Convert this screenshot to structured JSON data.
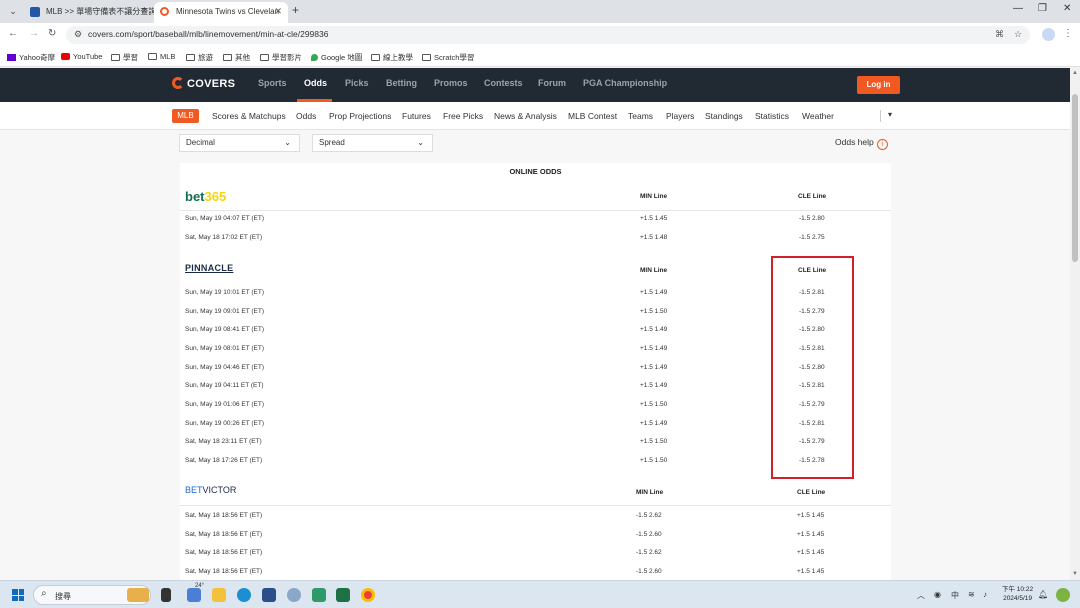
{
  "browser": {
    "tabs": [
      {
        "title": "MLB >> 單場守備表不讓分查詢"
      },
      {
        "title": "Minnesota Twins vs Clevelan"
      }
    ],
    "url": "covers.com/sport/baseball/mlb/linemovement/min-at-cle/299836",
    "bookmarks": [
      "Yahoo奇摩",
      "YouTube",
      "學習",
      "MLB",
      "旅遊",
      "其他",
      "學習影片",
      "Google 地圖",
      "線上教學",
      "Scratch學習"
    ]
  },
  "site": {
    "logo": "COVERS",
    "nav": [
      "Sports",
      "Odds",
      "Picks",
      "Betting",
      "Promos",
      "Contests",
      "Forum",
      "PGA Championship"
    ],
    "login": "Log in",
    "subnav": [
      "MLB",
      "Scores & Matchups",
      "Odds",
      "Prop Projections",
      "Futures",
      "Free Picks",
      "News & Analysis",
      "MLB Contest",
      "Teams",
      "Players",
      "Standings",
      "Statistics",
      "Weather"
    ]
  },
  "controls": {
    "format_select": "Decimal",
    "market_select": "Spread",
    "odds_help": "Odds help",
    "info_glyph": "i"
  },
  "panel": {
    "title": "ONLINE ODDS",
    "books": [
      {
        "name": "bet365",
        "name_part1": "bet",
        "name_part2": "365",
        "col1": "MIN Line",
        "col2": "CLE Line",
        "rows": [
          {
            "time": "Sun, May 19 04:07 ET (ET)",
            "min": "+1.5 1.45",
            "cle": "-1.5 2.80"
          },
          {
            "time": "Sat, May 18 17:02 ET (ET)",
            "min": "+1.5 1.48",
            "cle": "-1.5 2.75"
          }
        ]
      },
      {
        "name": "PINNACLE",
        "col1": "MIN Line",
        "col2": "CLE Line",
        "rows": [
          {
            "time": "Sun, May 19 10:01 ET (ET)",
            "min": "+1.5 1.49",
            "cle": "-1.5 2.81"
          },
          {
            "time": "Sun, May 19 09:01 ET (ET)",
            "min": "+1.5 1.50",
            "cle": "-1.5 2.79"
          },
          {
            "time": "Sun, May 19 08:41 ET (ET)",
            "min": "+1.5 1.49",
            "cle": "-1.5 2.80"
          },
          {
            "time": "Sun, May 19 08:01 ET (ET)",
            "min": "+1.5 1.49",
            "cle": "-1.5 2.81"
          },
          {
            "time": "Sun, May 19 04:46 ET (ET)",
            "min": "+1.5 1.49",
            "cle": "-1.5 2.80"
          },
          {
            "time": "Sun, May 19 04:11 ET (ET)",
            "min": "+1.5 1.49",
            "cle": "-1.5 2.81"
          },
          {
            "time": "Sun, May 19 01:06 ET (ET)",
            "min": "+1.5 1.50",
            "cle": "-1.5 2.79"
          },
          {
            "time": "Sun, May 19 00:26 ET (ET)",
            "min": "+1.5 1.49",
            "cle": "-1.5 2.81"
          },
          {
            "time": "Sat, May 18 23:11 ET (ET)",
            "min": "+1.5 1.50",
            "cle": "-1.5 2.79"
          },
          {
            "time": "Sat, May 18 17:26 ET (ET)",
            "min": "+1.5 1.50",
            "cle": "-1.5 2.78"
          }
        ]
      },
      {
        "name": "BETVICTOR",
        "name_part1": "BET",
        "name_part2": "VICTOR",
        "col1": "MIN Line",
        "col2": "CLE Line",
        "rows": [
          {
            "time": "Sat, May 18 18:56 ET (ET)",
            "min": "-1.5 2.62",
            "cle": "+1.5 1.45"
          },
          {
            "time": "Sat, May 18 18:56 ET (ET)",
            "min": "-1.5 2.60",
            "cle": "+1.5 1.45"
          },
          {
            "time": "Sat, May 18 18:56 ET (ET)",
            "min": "-1.5 2.62",
            "cle": "+1.5 1.45"
          },
          {
            "time": "Sat, May 18 18:56 ET (ET)",
            "min": "-1.5 2.60",
            "cle": "+1.5 1.45"
          }
        ]
      }
    ]
  },
  "taskbar": {
    "search_placeholder": "搜尋",
    "weather_temp": "24°",
    "ime": "中",
    "time": "下午 10:22",
    "date": "2024/5/19"
  },
  "colors": {
    "brand_orange": "#f05a22",
    "nav_dark": "#212a33",
    "highlight_red": "#d0212b",
    "bet365_green": "#126e51"
  }
}
